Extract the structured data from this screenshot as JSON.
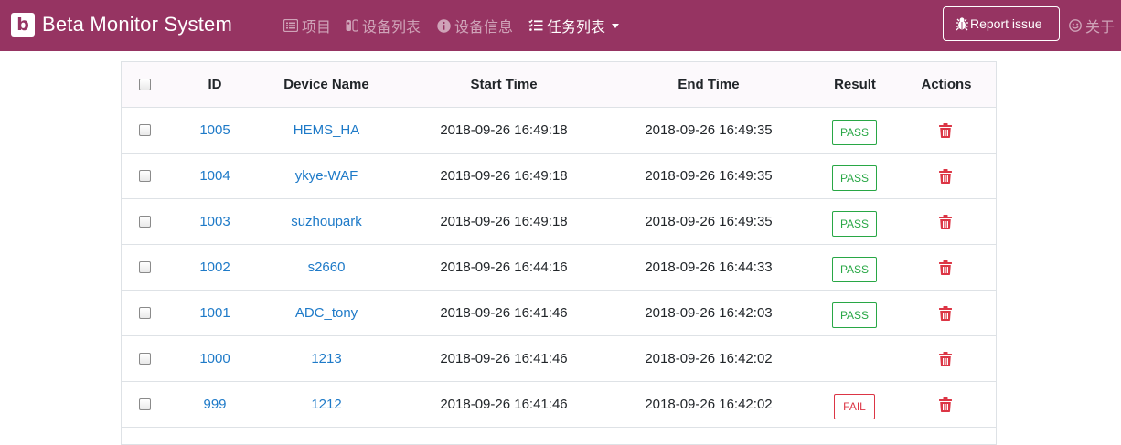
{
  "app": {
    "logo_letter": "b",
    "title": "Beta Monitor System"
  },
  "nav": {
    "items": [
      {
        "label": "项目",
        "icon": "list-icon"
      },
      {
        "label": "设备列表",
        "icon": "devices-icon"
      },
      {
        "label": "设备信息",
        "icon": "info-icon"
      },
      {
        "label": "任务列表",
        "icon": "tasks-icon",
        "active": true,
        "dropdown": true
      }
    ],
    "report_label": "Report issue",
    "about_label": "关于"
  },
  "table": {
    "headers": {
      "id": "ID",
      "device": "Device Name",
      "start": "Start Time",
      "end": "End Time",
      "result": "Result",
      "actions": "Actions"
    },
    "rows": [
      {
        "id": "1005",
        "device": "HEMS_HA",
        "start": "2018-09-26 16:49:18",
        "end": "2018-09-26 16:49:35",
        "result": "PASS"
      },
      {
        "id": "1004",
        "device": "ykye-WAF",
        "start": "2018-09-26 16:49:18",
        "end": "2018-09-26 16:49:35",
        "result": "PASS"
      },
      {
        "id": "1003",
        "device": "suzhoupark",
        "start": "2018-09-26 16:49:18",
        "end": "2018-09-26 16:49:35",
        "result": "PASS"
      },
      {
        "id": "1002",
        "device": "s2660",
        "start": "2018-09-26 16:44:16",
        "end": "2018-09-26 16:44:33",
        "result": "PASS"
      },
      {
        "id": "1001",
        "device": "ADC_tony",
        "start": "2018-09-26 16:41:46",
        "end": "2018-09-26 16:42:03",
        "result": "PASS"
      },
      {
        "id": "1000",
        "device": "1213",
        "start": "2018-09-26 16:41:46",
        "end": "2018-09-26 16:42:02",
        "result": ""
      },
      {
        "id": "999",
        "device": "1212",
        "start": "2018-09-26 16:41:46",
        "end": "2018-09-26 16:42:02",
        "result": "FAIL"
      }
    ]
  },
  "colors": {
    "navbar": "#963462",
    "pass": "#28a745",
    "fail": "#dc3545",
    "link": "#1e7ac8",
    "trash": "#dc3545"
  }
}
